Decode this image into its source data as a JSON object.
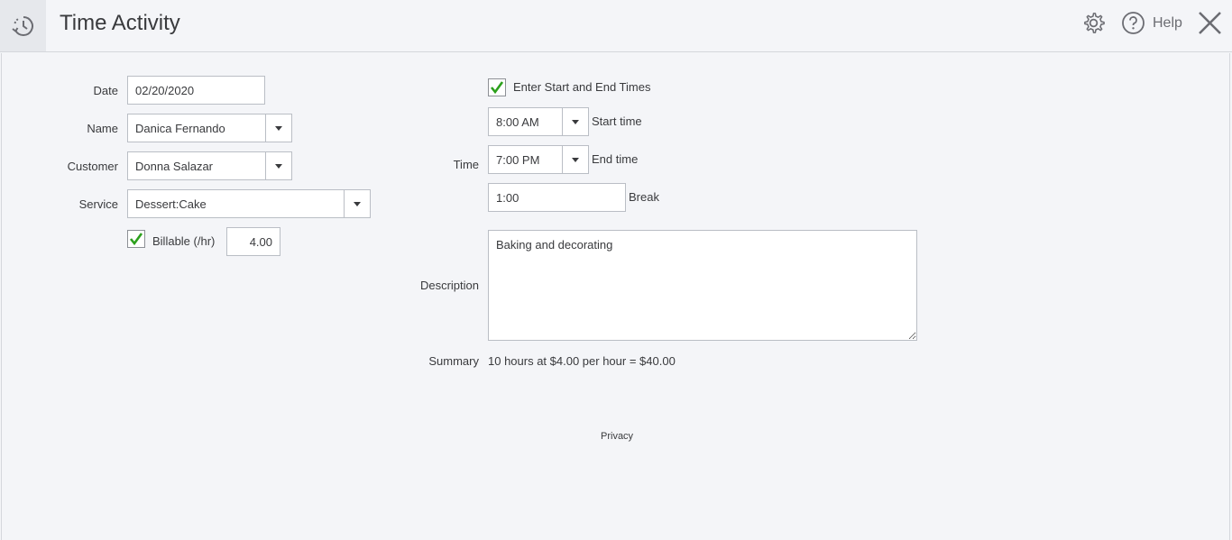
{
  "header": {
    "title": "Time Activity",
    "help_label": "Help",
    "icons": {
      "app": "time-activity-clock-icon",
      "settings": "gear-icon",
      "help": "question-circle-icon",
      "close": "close-icon"
    }
  },
  "form": {
    "date": {
      "label": "Date",
      "value": "02/20/2020"
    },
    "name": {
      "label": "Name",
      "value": "Danica Fernando"
    },
    "customer": {
      "label": "Customer",
      "value": "Donna Salazar"
    },
    "service": {
      "label": "Service",
      "value": "Dessert:Cake"
    },
    "billable": {
      "label": "Billable (/hr)",
      "checked": true,
      "rate": "4.00"
    },
    "enter_times": {
      "label": "Enter Start and End Times",
      "checked": true
    },
    "time": {
      "label": "Time",
      "start": {
        "value": "8:00 AM",
        "label": "Start time"
      },
      "end": {
        "value": "7:00 PM",
        "label": "End time"
      },
      "break": {
        "value": "1:00",
        "label": "Break"
      }
    },
    "description": {
      "label": "Description",
      "value": "Baking and decorating"
    },
    "summary": {
      "label": "Summary",
      "text": "10 hours at $4.00 per hour = $40.00"
    }
  },
  "footer": {
    "privacy_label": "Privacy"
  },
  "colors": {
    "check": "#2ca01c",
    "background": "#f4f5f8",
    "border": "#babec5"
  }
}
